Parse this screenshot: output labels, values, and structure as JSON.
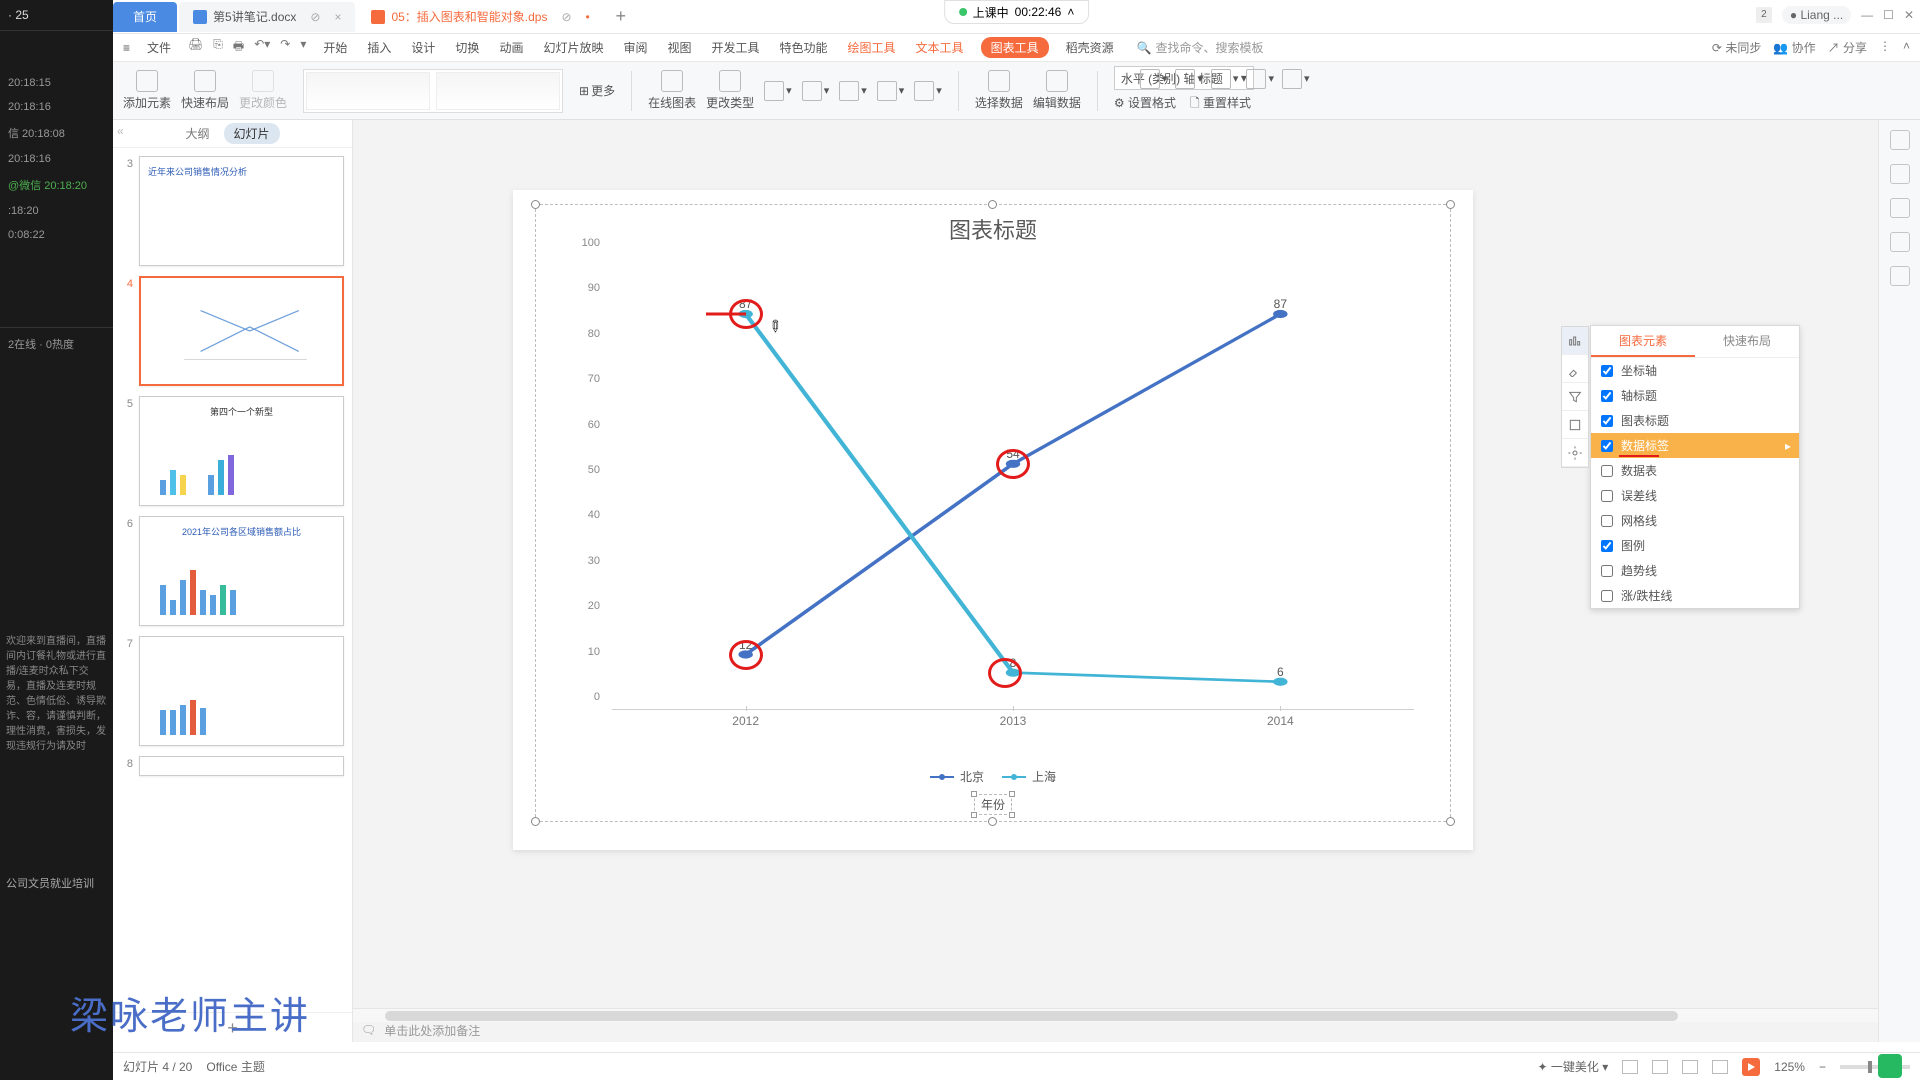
{
  "dark": {
    "top_num": "· 25",
    "rows": [
      "20:18:15",
      "20:18:16",
      "信  20:18:08",
      "20:18:16"
    ],
    "wx": "@微信  20:18:20",
    "row2": ":18:20",
    "row3": "0:08:22",
    "hot": "2在线 · 0热度",
    "notice": "欢迎来到直播间，直播间内订餐礼物或进行直播/连麦时众私下交易，直播及连麦时规范、色情低俗、诱导欺诈、容，请谨慎判断，理性消费，害损失，发现违规行为请及时",
    "train": "公司文员就业培训"
  },
  "tabs": {
    "home": "首页",
    "t1": "第5讲笔记.docx",
    "t2": "05：插入图表和智能对象.dps"
  },
  "timer": {
    "label": "上课中",
    "time": "00:22:46"
  },
  "topr": {
    "badge": "2",
    "user": "Liang ..."
  },
  "menu": {
    "file": "文件",
    "items": [
      "开始",
      "插入",
      "设计",
      "切换",
      "动画",
      "幻灯片放映",
      "审阅",
      "视图",
      "开发工具",
      "特色功能"
    ],
    "a1": "绘图工具",
    "a2": "文本工具",
    "a3": "图表工具",
    "a4": "稻壳资源",
    "search": "查找命令、搜索模板",
    "r": [
      "未同步",
      "协作",
      "分享"
    ]
  },
  "ribbon": {
    "b1": "添加元素",
    "b2": "快速布局",
    "b3": "更改颜色",
    "more": "更多",
    "g1": "在线图表",
    "g2": "更改类型",
    "g3": "选择数据",
    "g4": "编辑数据",
    "g5": "设置格式",
    "g6": "重置样式",
    "select": "水平 (类别) 轴 标题"
  },
  "sp": {
    "t1": "大纲",
    "t2": "幻灯片",
    "s3": "近年来公司销售情况分析",
    "s5": "第四个一个新型",
    "s6": "2021年公司各区域销售额占比"
  },
  "chart_data": {
    "type": "line",
    "title": "图表标题",
    "xlabel": "年份",
    "categories": [
      "2012",
      "2013",
      "2014"
    ],
    "series": [
      {
        "name": "北京",
        "values": [
          12,
          54,
          87
        ]
      },
      {
        "name": "上海",
        "values": [
          87,
          8,
          6
        ]
      }
    ],
    "ylim": [
      0,
      100
    ],
    "yticks": [
      0,
      10,
      20,
      30,
      40,
      50,
      60,
      70,
      80,
      90,
      100
    ]
  },
  "fpanel": {
    "t1": "图表元素",
    "t2": "快速布局",
    "o1": "坐标轴",
    "o2": "轴标题",
    "o3": "图表标题",
    "o4": "数据标签",
    "o5": "数据表",
    "o6": "误差线",
    "o7": "网格线",
    "o8": "图例",
    "o9": "趋势线",
    "o10": "涨/跌柱线"
  },
  "notes": {
    "ph": "单击此处添加备注"
  },
  "status": {
    "slide": "幻灯片 4 / 20",
    "theme": "Office 主题",
    "beauty": "一键美化",
    "zoom": "125%"
  },
  "watermark": "梁咏老师主讲"
}
